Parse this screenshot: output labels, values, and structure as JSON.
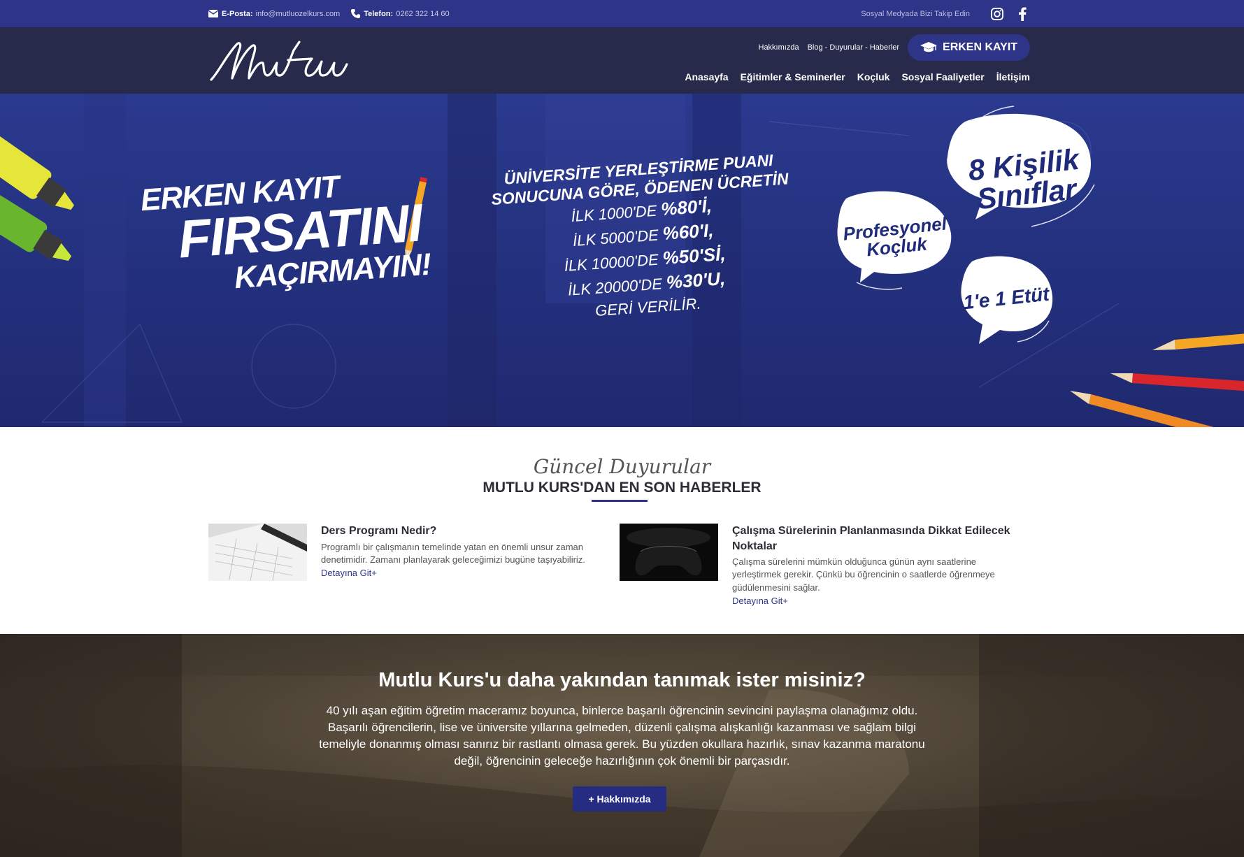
{
  "topbar": {
    "email_label": "E-Posta:",
    "email_value": "info@mutluozelkurs.com",
    "phone_label": "Telefon:",
    "phone_value": "0262 322 14 60",
    "social_text": "Sosyal Medyada Bizi Takip Edin",
    "icons": [
      "envelope-icon",
      "phone-icon",
      "instagram-icon",
      "facebook-icon"
    ]
  },
  "header": {
    "logo_text": "Mutlu",
    "top_links": [
      "Hakkımızda",
      "Blog - Duyurular - Haberler"
    ],
    "cta_label": "ERKEN KAYIT",
    "nav": [
      "Anasayfa",
      "Eğitimler & Seminerler",
      "Koçluk",
      "Sosyal Faaliyetler",
      "İletişim"
    ]
  },
  "hero": {
    "left_lines": [
      "ERKEN KAYIT",
      "FIRSATINI",
      "KAÇIRMAYIN!"
    ],
    "mid_head": [
      "ÜNİVERSİTE YERLEŞTİRME PUANI",
      "SONUCUNA GÖRE, ÖDENEN ÜCRETİN"
    ],
    "mid_rows": [
      {
        "prefix": "İLK 1000'DE",
        "value": "%80'İ,"
      },
      {
        "prefix": "İLK 5000'DE",
        "value": "%60'I,"
      },
      {
        "prefix": "İLK 10000'DE",
        "value": "%50'Sİ,"
      },
      {
        "prefix": "İLK 20000'DE",
        "value": "%30'U,"
      }
    ],
    "mid_tail": "GERİ VERİLİR.",
    "bubbles": {
      "classes": "8 Kişilik Sınıflar",
      "coaching": "Profesyonel Koçluk",
      "etut": "1'e 1 Etüt"
    }
  },
  "news": {
    "script_title": "Güncel Duyurular",
    "title": "MUTLU KURS'DAN EN SON HABERLER",
    "items": [
      {
        "title": "Ders Programı Nedir?",
        "desc": "Programlı bir çalışmanın temelinde yatan en önemli unsur zaman denetimidir. Zamanı planlayarak geleceğimizi bugüne taşıyabiliriz.",
        "more": "Detayına Git+"
      },
      {
        "title": "Çalışma Sürelerinin Planlanmasında Dikkat Edilecek Noktalar",
        "desc": "Çalışma sürelerini mümkün olduğunca günün aynı saatlerine yerleştirmek gerekir. Çünkü bu öğrencinin o saatlerde öğrenmeye güdülenmesini sağlar.",
        "more": "Detayına Git+"
      }
    ]
  },
  "about": {
    "heading": "Mutlu Kurs'u daha yakından tanımak ister misiniz?",
    "paragraph": "40 yılı aşan eğitim öğretim maceramız boyunca, binlerce başarılı öğrencinin sevincini paylaşma olanağımız oldu. Başarılı öğrencilerin, lise ve üniversite yıllarına gelmeden, düzenli çalışma alışkanlığı kazanması ve sağlam bilgi temeliyle donanmış olması sanırız bir rastlantı olmasa gerek. Bu yüzden okullara hazırlık, sınav kazanma maratonu değil, öğrencinin geleceğe hazırlığının çok önemli bir parçasıdır.",
    "button": "+ Hakkımızda"
  },
  "colors": {
    "brand": "#2e3488",
    "header_bg": "#272a4a",
    "hero_bg": "#23307d"
  }
}
